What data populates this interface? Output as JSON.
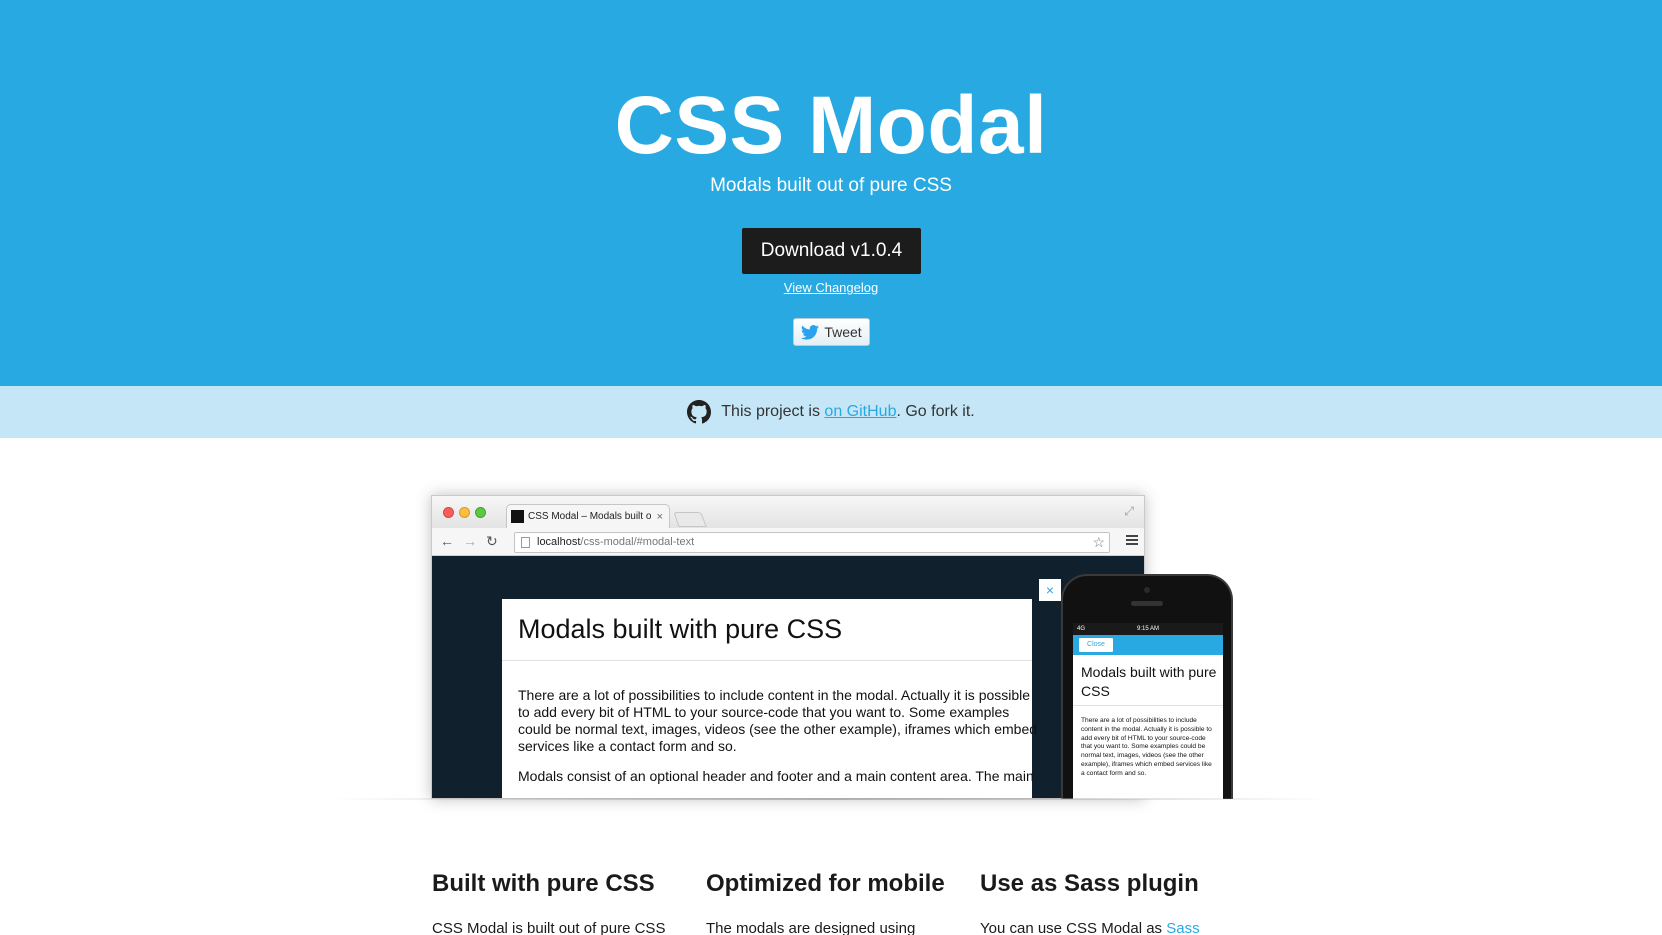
{
  "hero": {
    "title": "CSS Modal",
    "subtitle": "Modals built out of pure CSS",
    "download_label": "Download v1.0.4",
    "changelog_label": "View Changelog",
    "tweet_label": "Tweet"
  },
  "github_bar": {
    "prefix": "This project is",
    "link": "on GitHub",
    "suffix": ". Go fork it."
  },
  "browser": {
    "tab_title": "CSS Modal – Modals built o",
    "url_host": "localhost",
    "url_path": "/css-modal/#modal-text",
    "modal_title": "Modals built with pure CSS",
    "modal_p1": "There are a lot of possibilities to include content in the modal. Actually it is possible to add every bit of HTML to your source-code that you want to. Some examples could be normal text, images, videos (see the other example), iframes which embed services like a contact form and so.",
    "modal_p2": "Modals consist of an optional header and footer and a main content area. The main",
    "modal_close": "×"
  },
  "phone": {
    "carrier": "4G",
    "time": "9:15 AM",
    "close_label": "Close",
    "title": "Modals built with pure CSS",
    "text": "There are a lot of possibilities to include content in the modal. Actually it is possible to add every bit of HTML to your source-code that you want to. Some examples could be normal text, images, videos (see the other example), iframes which embed services like a contact form and so."
  },
  "features": [
    {
      "title": "Built with pure CSS",
      "text": "CSS Modal is built out of pure CSS"
    },
    {
      "title": "Optimized for mobile",
      "text": "The modals are designed using"
    },
    {
      "title": "Use as Sass plugin",
      "text": "You can use CSS Modal as",
      "link": "Sass"
    }
  ],
  "colors": {
    "accent": "#29a9e1",
    "github_bar": "#c4e6f7",
    "download_bg": "#1c1c1c"
  }
}
